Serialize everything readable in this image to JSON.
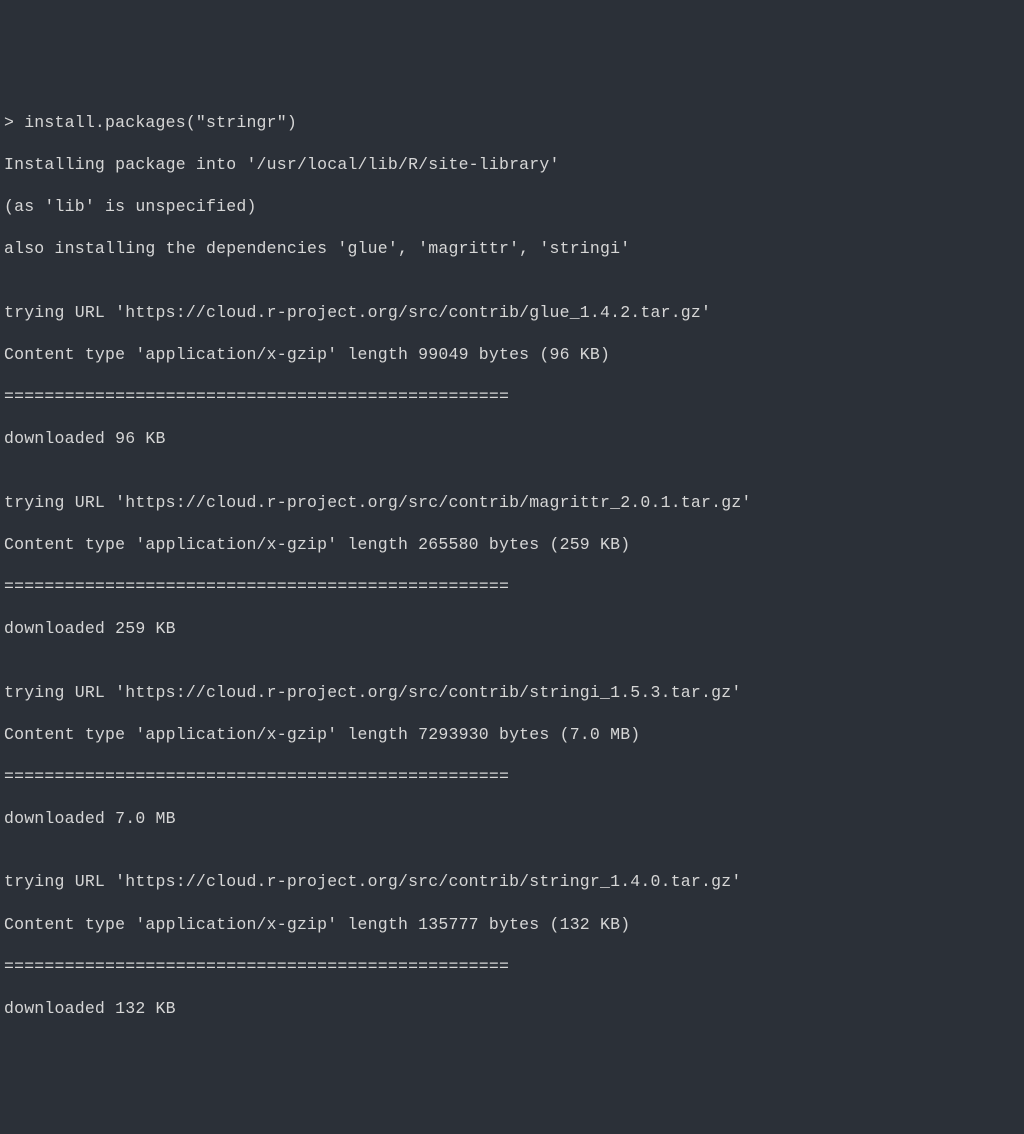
{
  "terminal": {
    "lines": [
      "> install.packages(\"stringr\")",
      "Installing package into '/usr/local/lib/R/site-library'",
      "(as 'lib' is unspecified)",
      "also installing the dependencies 'glue', 'magrittr', 'stringi'",
      "",
      "trying URL 'https://cloud.r-project.org/src/contrib/glue_1.4.2.tar.gz'",
      "Content type 'application/x-gzip' length 99049 bytes (96 KB)",
      "==================================================",
      "downloaded 96 KB",
      "",
      "trying URL 'https://cloud.r-project.org/src/contrib/magrittr_2.0.1.tar.gz'",
      "Content type 'application/x-gzip' length 265580 bytes (259 KB)",
      "==================================================",
      "downloaded 259 KB",
      "",
      "trying URL 'https://cloud.r-project.org/src/contrib/stringi_1.5.3.tar.gz'",
      "Content type 'application/x-gzip' length 7293930 bytes (7.0 MB)",
      "==================================================",
      "downloaded 7.0 MB",
      "",
      "trying URL 'https://cloud.r-project.org/src/contrib/stringr_1.4.0.tar.gz'",
      "Content type 'application/x-gzip' length 135777 bytes (132 KB)",
      "==================================================",
      "downloaded 132 KB"
    ]
  }
}
